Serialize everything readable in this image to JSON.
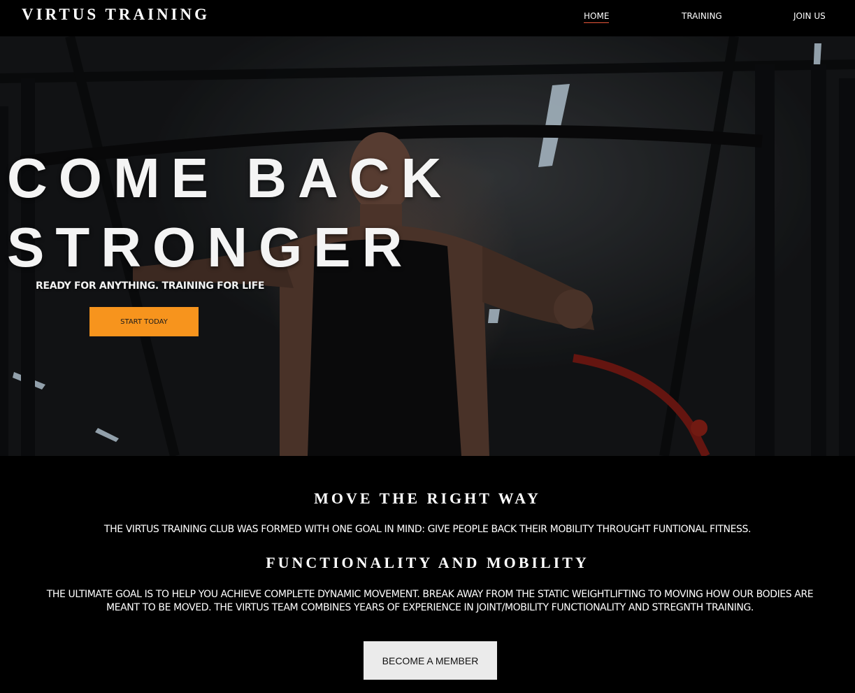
{
  "header": {
    "logo": "VIRTUS TRAINING",
    "nav": [
      {
        "label": "HOME",
        "active": true
      },
      {
        "label": "TRAINING",
        "active": false
      },
      {
        "label": "JOIN US",
        "active": false
      }
    ]
  },
  "hero": {
    "title_line1": "COME BACK",
    "title_line2": "STRONGER",
    "subtitle": "READY FOR ANYTHING. TRAINING FOR LIFE",
    "cta_label": "START TODAY"
  },
  "about": {
    "heading1": "MOVE THE RIGHT WAY",
    "text1": "THE VIRTUS TRAINING CLUB WAS FORMED WITH ONE GOAL IN MIND: GIVE PEOPLE BACK THEIR MOBILITY THROUGHT FUNTIONAL FITNESS.",
    "heading2": "FUNCTIONALITY AND MOBILITY",
    "text2": "THE ULTIMATE GOAL IS TO HELP YOU ACHIEVE COMPLETE DYNAMIC MOVEMENT. BREAK AWAY FROM THE STATIC WEIGHTLIFTING TO MOVING HOW OUR BODIES ARE MEANT TO BE MOVED. THE VIRTUS TEAM COMBINES YEARS OF EXPERIENCE IN JOINT/MOBILITY FUNCTIONALITY AND STREGNTH TRAINING.",
    "member_button": "BECOME A MEMBER"
  },
  "colors": {
    "cta": "#f7941d",
    "nav_active_underline": "#e8573a",
    "member_button": "#ebebeb",
    "background": "#000000"
  }
}
